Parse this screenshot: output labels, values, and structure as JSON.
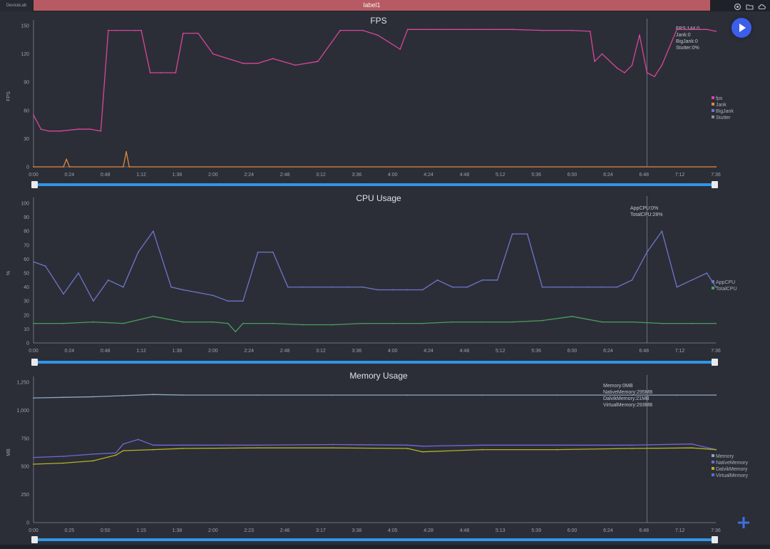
{
  "app": {
    "name": "DeviceLab",
    "window_title": "label1"
  },
  "top_icons": [
    "settings-icon",
    "folder-icon",
    "cloud-icon"
  ],
  "colors": {
    "fps": "#d9459a",
    "jank": "#e2883d",
    "app_cpu": "#6f75c9",
    "total_cpu": "#4aa05a",
    "memory": "#8fa7c0",
    "native": "#7068d6",
    "dalvik": "#b8b21f",
    "virtual": "#5c6fd0",
    "slider": "#2f96e8",
    "play": "#3d5ee8"
  },
  "fps_panel": {
    "title": "FPS",
    "ylabel": "FPS",
    "yticks": [
      "0",
      "30",
      "60",
      "90",
      "120",
      "150"
    ],
    "xticks": [
      "0:00",
      "0:24",
      "0:48",
      "1:12",
      "1:36",
      "2:00",
      "2:24",
      "2:48",
      "3:12",
      "3:36",
      "4:00",
      "4:24",
      "4:48",
      "5:12",
      "5:36",
      "6:00",
      "6:24",
      "6:48",
      "7:12",
      "7:36"
    ],
    "tooltip": [
      "FPS:144.0",
      "Jank:0",
      "BigJank:0",
      "Stutter:0%"
    ],
    "legend": [
      "fps",
      "Jank",
      "BigJank",
      "Stutter"
    ],
    "legend_colors": [
      "#d9459a",
      "#e2883d",
      "#6f75c9",
      "#8a8fa0"
    ]
  },
  "cpu_panel": {
    "title": "CPU Usage",
    "ylabel": "%",
    "yticks": [
      "0",
      "10",
      "20",
      "30",
      "40",
      "50",
      "60",
      "70",
      "80",
      "90",
      "100"
    ],
    "xticks": [
      "0:00",
      "0:24",
      "0:48",
      "1:12",
      "1:36",
      "2:00",
      "2:24",
      "2:48",
      "3:12",
      "3:36",
      "4:00",
      "4:24",
      "4:48",
      "5:12",
      "5:36",
      "6:00",
      "6:24",
      "6:48",
      "7:12",
      "7:36"
    ],
    "tooltip": [
      "AppCPU:0%",
      "TotalCPU:28%"
    ],
    "legend": [
      "AppCPU",
      "TotalCPU"
    ],
    "legend_colors": [
      "#6f75c9",
      "#4aa05a"
    ]
  },
  "memory_panel": {
    "title": "Memory Usage",
    "ylabel": "MB",
    "yticks": [
      "0",
      "250",
      "500",
      "750",
      "1,000",
      "1,250"
    ],
    "xticks": [
      "0:00",
      "0:25",
      "0:50",
      "1:15",
      "1:38",
      "2:00",
      "2:23",
      "2:46",
      "3:17",
      "3:38",
      "4:05",
      "4:28",
      "4:48",
      "5:13",
      "5:39",
      "6:00",
      "6:24",
      "6:48",
      "7:12",
      "7:36"
    ],
    "tooltip": [
      "Memory:0MB",
      "NativeMemory:295MB",
      "DalvikMemory:21MB",
      "VirtualMemory:293MB"
    ],
    "legend": [
      "Memory",
      "NativeMemory",
      "DalvikMemory",
      "VirtualMemory"
    ],
    "legend_colors": [
      "#8fa7c0",
      "#7068d6",
      "#b8b21f",
      "#5c6fd0"
    ]
  },
  "chart_data": [
    {
      "type": "line",
      "title": "FPS",
      "ylabel": "FPS",
      "ylim": [
        0,
        150
      ],
      "xlim_seconds": [
        0,
        456
      ],
      "series": [
        {
          "name": "fps",
          "x": [
            0,
            5,
            10,
            18,
            30,
            38,
            45,
            50,
            55,
            68,
            72,
            78,
            85,
            95,
            100,
            110,
            120,
            140,
            150,
            160,
            175,
            190,
            205,
            220,
            230,
            245,
            250,
            265,
            275,
            290,
            305,
            320,
            340,
            360,
            372,
            375,
            380,
            390,
            395,
            400,
            405,
            410,
            415,
            420,
            430,
            445,
            450,
            456
          ],
          "y": [
            55,
            40,
            38,
            38,
            40,
            40,
            38,
            145,
            145,
            145,
            145,
            100,
            100,
            100,
            142,
            142,
            120,
            110,
            110,
            115,
            108,
            112,
            145,
            145,
            140,
            125,
            146,
            146,
            146,
            146,
            146,
            146,
            145,
            145,
            144,
            112,
            120,
            105,
            100,
            108,
            140,
            100,
            96,
            108,
            146,
            146,
            146,
            144
          ]
        },
        {
          "name": "Jank",
          "x": [
            0,
            20,
            22,
            24,
            60,
            62,
            64,
            456
          ],
          "y": [
            0,
            0,
            8,
            0,
            0,
            16,
            0,
            0
          ]
        }
      ]
    },
    {
      "type": "line",
      "title": "CPU Usage",
      "ylabel": "%",
      "ylim": [
        0,
        100
      ],
      "xlim_seconds": [
        0,
        456
      ],
      "series": [
        {
          "name": "AppCPU",
          "x": [
            0,
            8,
            20,
            30,
            40,
            50,
            60,
            70,
            80,
            92,
            100,
            110,
            120,
            130,
            140,
            150,
            160,
            170,
            180,
            190,
            200,
            210,
            220,
            230,
            240,
            250,
            260,
            270,
            280,
            290,
            300,
            310,
            320,
            330,
            340,
            350,
            360,
            370,
            380,
            390,
            400,
            410,
            420,
            430,
            440,
            450,
            456
          ],
          "y": [
            58,
            55,
            35,
            50,
            30,
            45,
            40,
            65,
            80,
            40,
            38,
            36,
            34,
            30,
            30,
            65,
            65,
            40,
            40,
            40,
            40,
            40,
            40,
            38,
            38,
            38,
            38,
            45,
            40,
            40,
            45,
            45,
            78,
            78,
            40,
            40,
            40,
            40,
            40,
            40,
            45,
            65,
            80,
            40,
            45,
            50,
            40
          ]
        },
        {
          "name": "TotalCPU",
          "x": [
            0,
            20,
            40,
            60,
            80,
            100,
            120,
            130,
            135,
            140,
            160,
            180,
            200,
            220,
            240,
            260,
            280,
            300,
            320,
            340,
            360,
            380,
            400,
            420,
            440,
            456
          ],
          "y": [
            14,
            14,
            15,
            14,
            19,
            15,
            15,
            14,
            8,
            14,
            14,
            13,
            13,
            14,
            14,
            14,
            15,
            15,
            15,
            16,
            19,
            15,
            15,
            14,
            14,
            14
          ]
        }
      ]
    },
    {
      "type": "line",
      "title": "Memory Usage",
      "ylabel": "MB",
      "ylim": [
        0,
        1250
      ],
      "xlim_seconds": [
        0,
        456
      ],
      "series": [
        {
          "name": "Memory",
          "x": [
            0,
            20,
            40,
            60,
            80,
            100,
            150,
            200,
            250,
            300,
            350,
            400,
            430,
            456
          ],
          "y": [
            1110,
            1115,
            1120,
            1130,
            1140,
            1135,
            1135,
            1135,
            1135,
            1135,
            1135,
            1135,
            1135,
            1135
          ]
        },
        {
          "name": "NativeMemory",
          "x": [
            0,
            20,
            40,
            55,
            60,
            70,
            80,
            100,
            150,
            200,
            250,
            260,
            300,
            350,
            400,
            440,
            456
          ],
          "y": [
            580,
            590,
            610,
            620,
            700,
            740,
            690,
            690,
            690,
            695,
            690,
            680,
            690,
            690,
            690,
            700,
            650
          ]
        },
        {
          "name": "DalvikMemory",
          "x": [
            0,
            20,
            40,
            55,
            60,
            80,
            100,
            150,
            200,
            250,
            260,
            300,
            350,
            400,
            440,
            456
          ],
          "y": [
            520,
            530,
            550,
            600,
            640,
            650,
            660,
            665,
            665,
            660,
            630,
            650,
            650,
            660,
            665,
            650
          ]
        }
      ]
    }
  ]
}
